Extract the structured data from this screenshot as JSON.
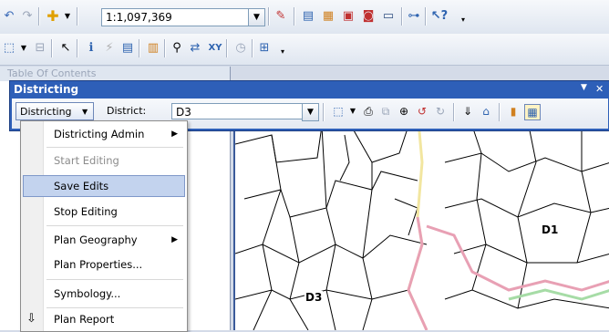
{
  "toolbar": {
    "scale_value": "1:1,097,369"
  },
  "toc": {
    "title": "Table Of Contents"
  },
  "districting_window": {
    "title": "Districting",
    "menu_button_label": "Districting",
    "district_label": "District:",
    "district_value": "D3"
  },
  "menu": {
    "items": [
      {
        "label": "Districting Admin",
        "submenu": true,
        "enabled": true
      },
      {
        "label": "Start Editing",
        "submenu": false,
        "enabled": false
      },
      {
        "label": "Save Edits",
        "submenu": false,
        "enabled": true,
        "highlighted": true
      },
      {
        "label": "Stop Editing",
        "submenu": false,
        "enabled": true
      },
      {
        "label": "Plan Geography",
        "submenu": true,
        "enabled": true
      },
      {
        "label": "Plan Properties...",
        "submenu": false,
        "enabled": true
      },
      {
        "label": "Symbology...",
        "submenu": false,
        "enabled": true
      },
      {
        "label": "Plan Report",
        "submenu": false,
        "enabled": true
      }
    ]
  },
  "map": {
    "labels": [
      {
        "text": "D1"
      },
      {
        "text": "D3"
      }
    ],
    "colors": {
      "d1_boundary": "#e8a0b4",
      "d3_boundary": "#f2e6a0",
      "other_boundary": "#a6dca6"
    }
  },
  "colors": {
    "title_bar": "#2e5fb8",
    "menu_highlight": "#c3d3ee"
  }
}
